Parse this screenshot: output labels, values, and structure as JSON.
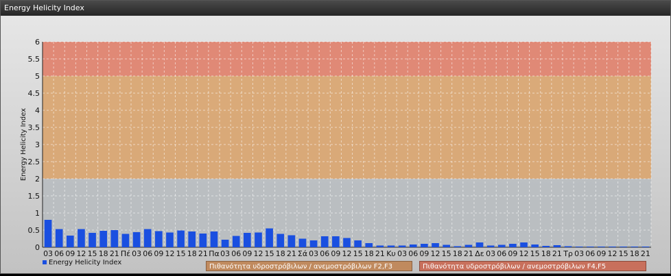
{
  "window": {
    "title": "Energy Helicity Index"
  },
  "chart_data": {
    "type": "bar",
    "ylabel": "Energy Helicity Index",
    "ylim": [
      0,
      6
    ],
    "yticks": [
      "0",
      "0.5",
      "1",
      "1.5",
      "2",
      "2.5",
      "3",
      "3.5",
      "4",
      "4.5",
      "5",
      "5.5",
      "6"
    ],
    "bands": [
      {
        "from": 0,
        "to": 2,
        "color": "#b8bcc0"
      },
      {
        "from": 2,
        "to": 5,
        "color": "#d9a46e"
      },
      {
        "from": 5,
        "to": 6,
        "color": "#e0806a"
      }
    ],
    "categories": [
      "03",
      "06",
      "09",
      "12",
      "15",
      "18",
      "21",
      "Πέ",
      "03",
      "06",
      "09",
      "12",
      "15",
      "18",
      "21",
      "Πα",
      "03",
      "06",
      "09",
      "12",
      "15",
      "18",
      "21",
      "Σά",
      "03",
      "06",
      "09",
      "12",
      "15",
      "18",
      "21",
      "Κυ",
      "03",
      "06",
      "09",
      "12",
      "15",
      "18",
      "21",
      "Δε",
      "03",
      "06",
      "09",
      "12",
      "15",
      "18",
      "21",
      "Τρ",
      "03",
      "06",
      "09",
      "12",
      "15",
      "18",
      "21"
    ],
    "series": [
      {
        "name": "Energy Helicity Index",
        "color": "#1a4fe0",
        "values": [
          0.8,
          0.53,
          0.34,
          0.53,
          0.42,
          0.48,
          0.5,
          0.39,
          0.44,
          0.53,
          0.47,
          0.43,
          0.49,
          0.46,
          0.4,
          0.46,
          0.22,
          0.33,
          0.42,
          0.43,
          0.55,
          0.39,
          0.35,
          0.25,
          0.2,
          0.32,
          0.32,
          0.27,
          0.2,
          0.12,
          0.05,
          0.05,
          0.05,
          0.08,
          0.1,
          0.12,
          0.07,
          0.03,
          0.07,
          0.14,
          0.05,
          0.07,
          0.1,
          0.14,
          0.08,
          0.04,
          0.06,
          0.03,
          0.02,
          0.02,
          0.02,
          0.02,
          0.02,
          0.02,
          0.02
        ]
      }
    ],
    "legend": [
      {
        "label": "Energy Helicity Index",
        "color": "#1a4fe0"
      },
      {
        "label": "Πιθανότητα υδροστρόβιλων / ανεμοστρόβιλων F2,F3",
        "color": "#c08a5e"
      },
      {
        "label": "Πιθανότητα υδροστρόβιλων / ανεμοστρόβιλων F4,F5",
        "color": "#c8705c"
      }
    ]
  }
}
